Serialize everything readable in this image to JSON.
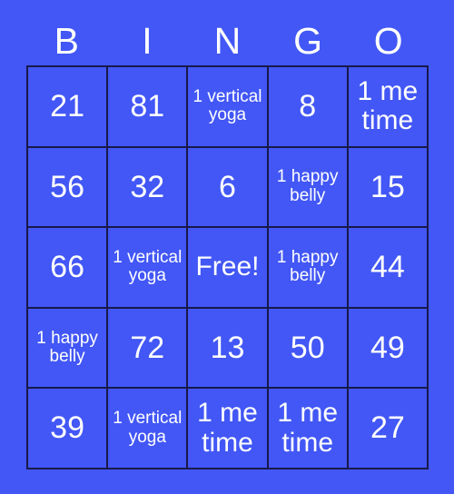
{
  "card": {
    "header": {
      "letters": [
        "B",
        "I",
        "N",
        "G",
        "O"
      ]
    },
    "colors": {
      "background": "#4257f5",
      "cell_fill": "#4257f5",
      "grid_line": "#18194a",
      "text": "#ffffff"
    },
    "grid": {
      "columns": 5,
      "rows": 5,
      "cells": [
        {
          "text": "21",
          "kind": "number"
        },
        {
          "text": "81",
          "kind": "number"
        },
        {
          "text": "1 vertical yoga",
          "kind": "phrase-long"
        },
        {
          "text": "8",
          "kind": "number"
        },
        {
          "text": "1 me time",
          "kind": "phrase-short"
        },
        {
          "text": "56",
          "kind": "number"
        },
        {
          "text": "32",
          "kind": "number"
        },
        {
          "text": "6",
          "kind": "number"
        },
        {
          "text": "1 happy belly",
          "kind": "phrase-long"
        },
        {
          "text": "15",
          "kind": "number"
        },
        {
          "text": "66",
          "kind": "number"
        },
        {
          "text": "1 vertical yoga",
          "kind": "phrase-long"
        },
        {
          "text": "Free!",
          "kind": "free"
        },
        {
          "text": "1 happy belly",
          "kind": "phrase-long"
        },
        {
          "text": "44",
          "kind": "number"
        },
        {
          "text": "1 happy belly",
          "kind": "phrase-long"
        },
        {
          "text": "72",
          "kind": "number"
        },
        {
          "text": "13",
          "kind": "number"
        },
        {
          "text": "50",
          "kind": "number"
        },
        {
          "text": "49",
          "kind": "number"
        },
        {
          "text": "39",
          "kind": "number"
        },
        {
          "text": "1 vertical yoga",
          "kind": "phrase-long"
        },
        {
          "text": "1 me time",
          "kind": "phrase-short"
        },
        {
          "text": "1 me time",
          "kind": "phrase-short"
        },
        {
          "text": "27",
          "kind": "number"
        }
      ]
    }
  }
}
